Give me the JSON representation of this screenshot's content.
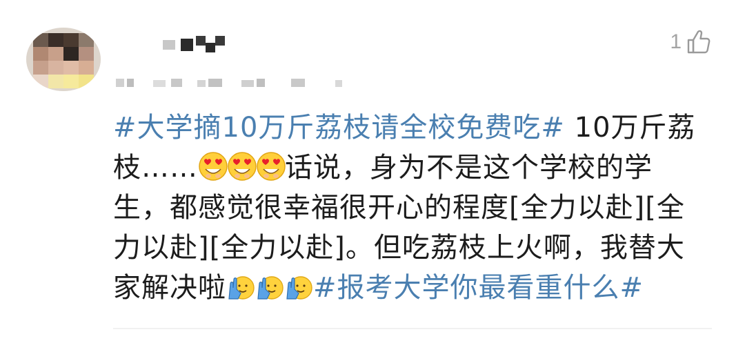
{
  "comment": {
    "like_count": "1",
    "lines": {
      "l1_topic": "#大学摘10万斤荔枝请全校免费吃#",
      "l1_text": " 10万斤荔",
      "l2_text_a": "枝……",
      "l2_text_b": "话说，身为不是这个学校的学",
      "l3_text": "生，都感觉很幸福很开心的程度[全力以赴][全",
      "l4_text": "力以赴][全力以赴]。但吃荔枝上火啊，我替大",
      "l5_text": "家解决啦",
      "l5_topic": "#报考大学你最看重什么#"
    },
    "emojis": {
      "heart_eyes": "heart-eyes-emoji",
      "raised_hand": "raised-hand-emoji"
    }
  },
  "colors": {
    "topic": "#4a7fb0",
    "text": "#1c1c1c",
    "meta": "#a4a4a4"
  }
}
